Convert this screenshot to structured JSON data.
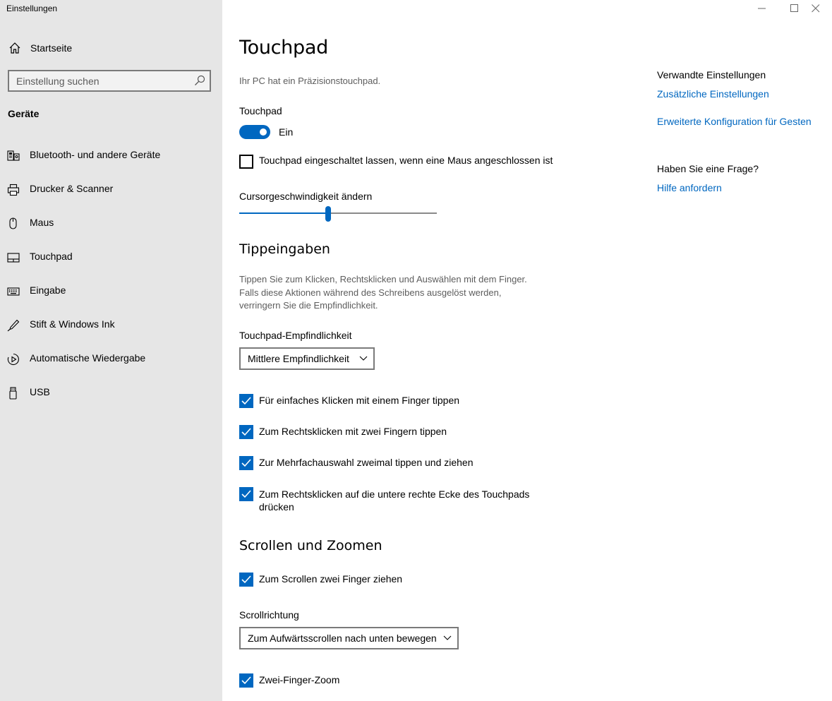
{
  "window": {
    "title": "Einstellungen",
    "controls": [
      "minimize",
      "maximize",
      "close"
    ]
  },
  "sidebar": {
    "home_label": "Startseite",
    "search_placeholder": "Einstellung suchen",
    "section_title": "Geräte",
    "items": [
      {
        "label": "Bluetooth- und andere Geräte",
        "icon": "bluetooth-devices-icon"
      },
      {
        "label": "Drucker & Scanner",
        "icon": "printer-icon"
      },
      {
        "label": "Maus",
        "icon": "mouse-icon"
      },
      {
        "label": "Touchpad",
        "icon": "touchpad-icon"
      },
      {
        "label": "Eingabe",
        "icon": "keyboard-icon"
      },
      {
        "label": "Stift & Windows Ink",
        "icon": "pen-icon"
      },
      {
        "label": "Automatische Wiedergabe",
        "icon": "autoplay-icon"
      },
      {
        "label": "USB",
        "icon": "usb-icon"
      }
    ]
  },
  "main": {
    "title": "Touchpad",
    "precision_info": "Ihr PC hat ein Präzisionstouchpad.",
    "touchpad_label": "Touchpad",
    "toggle_state": "Ein",
    "keep_on_label": "Touchpad eingeschaltet lassen, wenn eine Maus angeschlossen ist",
    "cursor_speed_label": "Cursorgeschwindigkeit ändern",
    "cursor_speed_fraction": 0.45,
    "taps": {
      "title": "Tippeingaben",
      "description": [
        "Tippen Sie zum Klicken, Rechtsklicken und Auswählen mit dem Finger.",
        "Falls diese Aktionen während des Schreibens ausgelöst werden,",
        "verringern Sie die Empfindlichkeit."
      ],
      "sensitivity_label": "Touchpad-Empfindlichkeit",
      "sensitivity_value": "Mittlere Empfindlichkeit",
      "options": [
        {
          "label": "Für einfaches Klicken mit einem Finger tippen",
          "checked": true
        },
        {
          "label": "Zum Rechtsklicken mit zwei Fingern tippen",
          "checked": true
        },
        {
          "label": "Zur Mehrfachauswahl zweimal tippen und ziehen",
          "checked": true
        },
        {
          "label": "Zum Rechtsklicken auf die untere rechte Ecke des Touchpads",
          "label_line2": "drücken",
          "checked": true
        }
      ]
    },
    "scroll": {
      "title": "Scrollen und Zoomen",
      "two_finger_scroll_label": "Zum Scrollen zwei Finger ziehen",
      "direction_label": "Scrollrichtung",
      "direction_value": "Zum Aufwärtsscrollen nach unten bewegen",
      "zoom_label": "Zwei-Finger-Zoom"
    }
  },
  "related": {
    "title": "Verwandte Einstellungen",
    "link1": "Zusätzliche Einstellungen",
    "link2": "Erweiterte Konfiguration für Gesten",
    "question_title": "Haben Sie eine Frage?",
    "help_link": "Hilfe anfordern"
  },
  "colors": {
    "accent": "#0067c0",
    "sidebar_bg": "#e6e6e6"
  }
}
